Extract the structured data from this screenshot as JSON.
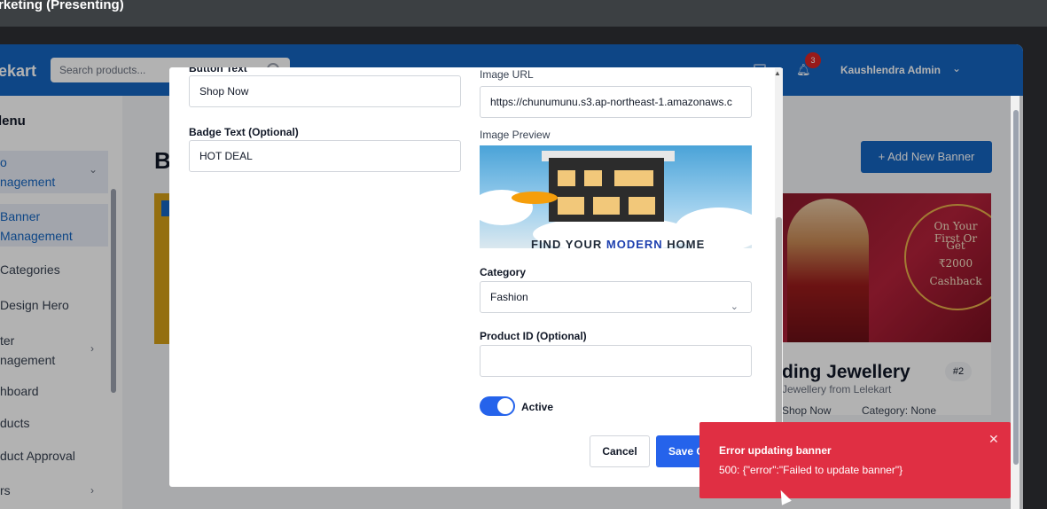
{
  "meeting": {
    "title": "rketing (Presenting)"
  },
  "header": {
    "logo": "ekart",
    "search_placeholder": "Search products...",
    "notification_count": "3",
    "user_name": "Kaushlendra Admin"
  },
  "sidebar": {
    "title": "lenu",
    "items": [
      {
        "label": "o\nnagement"
      },
      {
        "label": "Banner\nManagement"
      },
      {
        "label": "Categories"
      },
      {
        "label": "Design Hero"
      },
      {
        "label": "ter\nnagement"
      },
      {
        "label": "hboard"
      },
      {
        "label": "ducts"
      },
      {
        "label": "duct Approval"
      },
      {
        "label": "rs"
      }
    ]
  },
  "main": {
    "heading": "B",
    "add_button": "+ Add New Banner",
    "card": {
      "title": "ding Jewellery",
      "subtitle": "Jewellery from Lelekart",
      "number": "#2",
      "button_text": "Shop Now",
      "category_label": "Category:",
      "category_value": "None",
      "image_text": [
        "On Your First Or",
        "Get",
        "₹2000",
        "Cashback"
      ]
    }
  },
  "modal": {
    "button_text_label": "Button Text",
    "button_text_value": "Shop Now",
    "badge_text_label": "Badge Text (Optional)",
    "badge_text_value": "HOT DEAL",
    "image_url_label": "Image URL",
    "image_url_value": "https://chunumunu.s3.ap-northeast-1.amazonaws.c",
    "image_preview_label": "Image Preview",
    "preview_caption_a": "FIND YOUR ",
    "preview_caption_b": "MODERN",
    "preview_caption_c": " HOME",
    "category_label": "Category",
    "category_value": "Fashion",
    "product_id_label": "Product ID (Optional)",
    "product_id_value": "",
    "active_label": "Active",
    "active": true,
    "cancel_label": "Cancel",
    "save_label": "Save C"
  },
  "toast": {
    "title": "Error updating banner",
    "message": "500: {\"error\":\"Failed to update banner\"}",
    "color": "#e02f43"
  },
  "colors": {
    "primary": "#1565c0",
    "accent": "#2563eb",
    "error": "#e02f43"
  }
}
